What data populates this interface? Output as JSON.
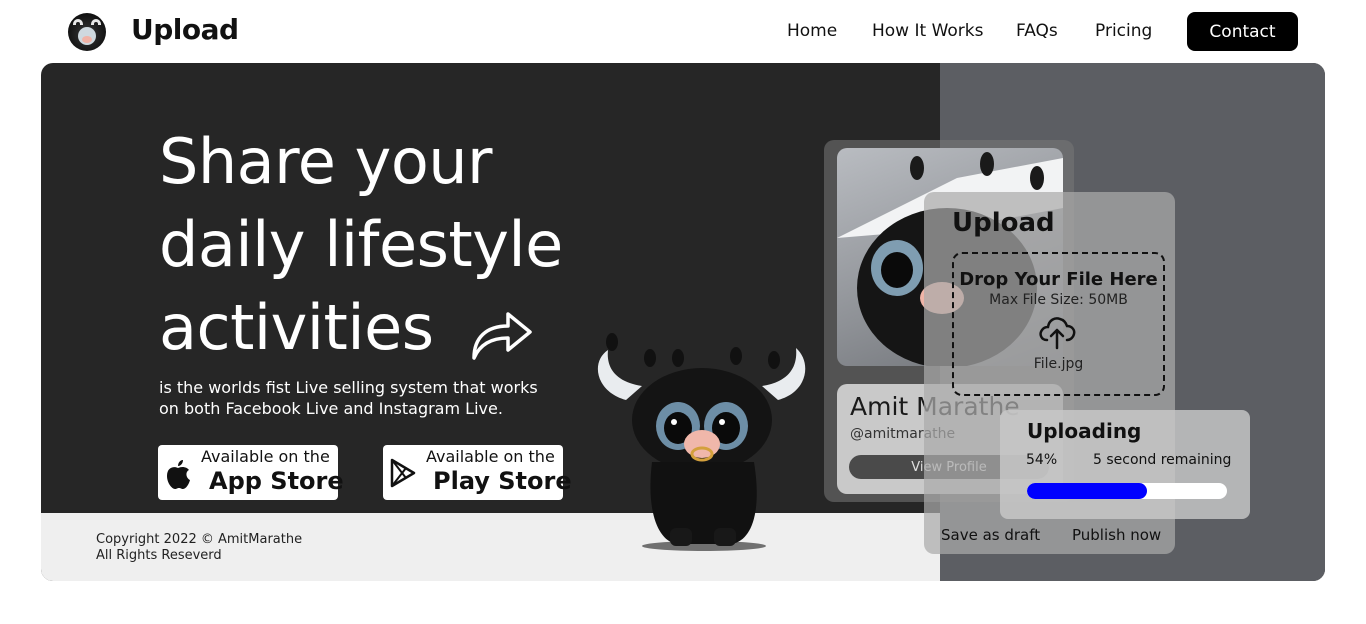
{
  "header": {
    "brand": "Upload",
    "nav": [
      "Home",
      "How It Works",
      "FAQs",
      "Pricing"
    ],
    "contact_label": "Contact"
  },
  "hero": {
    "headline": [
      "Share your",
      "daily lifestyle",
      "activities"
    ],
    "subtext_lines": [
      "is the worlds fist Live selling system that works",
      "on both Facebook Live and Instagram Live."
    ],
    "app_store": {
      "small": "Available on the",
      "big": "App Store"
    },
    "play_store": {
      "small": "Available on the",
      "big": "Play Store"
    }
  },
  "footer": {
    "copyright": "Copyright 2022 © AmitMarathe",
    "rights": "All Rights Reseverd"
  },
  "profile": {
    "name": "Amit Marathe",
    "handle": "@amitmarathe",
    "view_label": "View Profile"
  },
  "upload": {
    "title": "Upload",
    "drop_title": "Drop Your File Here",
    "max_size": "Max File Size: 50MB",
    "file_name": "File.jpg",
    "save_draft": "Save as draft",
    "publish": "Publish now"
  },
  "uploading": {
    "title": "Uploading",
    "percent_label": "54%",
    "progress": 0.6,
    "remaining": "5 second remaining"
  },
  "colors": {
    "card_dark": "#262626",
    "right_panel": "#5c5e63",
    "progress_fill": "#0000ff",
    "footer_band": "#efefef"
  },
  "icons": [
    "logo-bull-icon",
    "share-arrow-icon",
    "apple-icon",
    "play-store-icon",
    "cloud-upload-icon"
  ]
}
